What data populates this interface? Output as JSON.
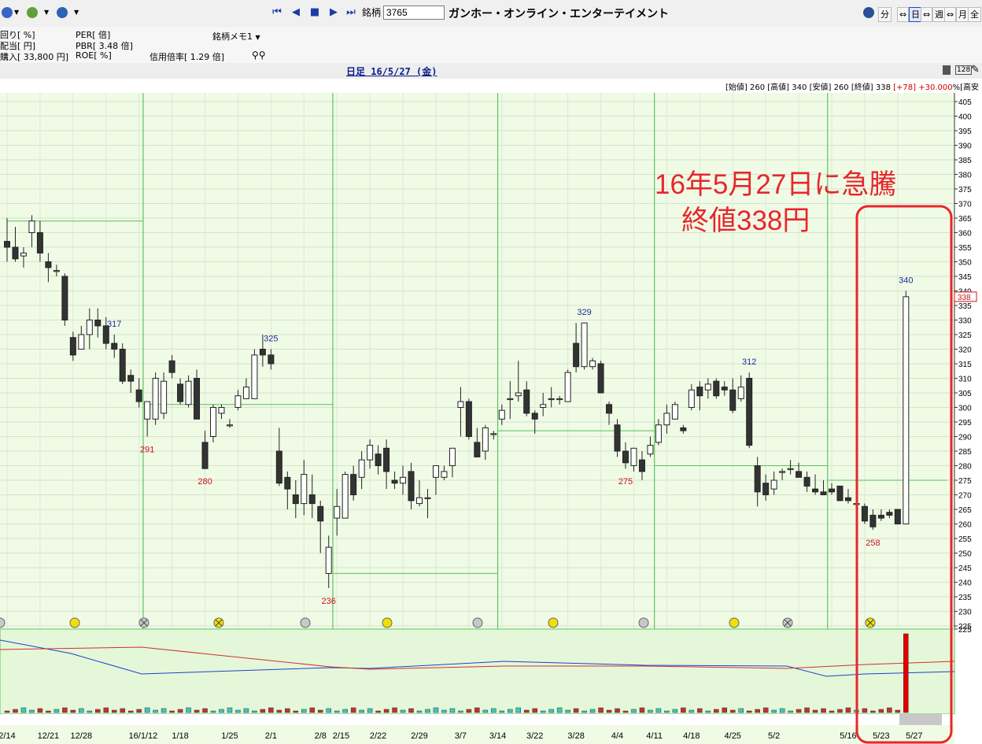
{
  "toolbar": {
    "code_label": "銘柄",
    "code_value": "3765",
    "company_name": "ガンホー・オンライン・エンターテイメント",
    "timeframes": [
      "分",
      "日",
      "週",
      "月",
      "全"
    ],
    "active_timeframe": "日"
  },
  "info": {
    "yield": "回り[ %]",
    "dividend": "配当[ 円]",
    "purchase": "購入[ 33,800 円]",
    "per": "PER[ 倍]",
    "pbr": "PBR[ 3.48 倍]",
    "roe": "ROE[ %]",
    "memo": "銘柄メモ1",
    "margin_ratio": "信用倍率[ 1.29 倍]"
  },
  "chart_title": "日足 16/5/27 (金)",
  "ohlc": {
    "open_label": "[始値]",
    "open": "260",
    "high_label": "[高値]",
    "high": "340",
    "low_label": "[安値]",
    "low": "260",
    "close_label": "[終値]",
    "close": "338",
    "change": "[+78]",
    "change_pct": "+30.000",
    "trail": "%[高安"
  },
  "annotation": {
    "line1": "16年5月27日に急騰",
    "line2": "終値338円"
  },
  "chart_data": {
    "type": "candlestick",
    "title": "日足 16/5/27 (金)",
    "colors": {
      "up": "#ffffff",
      "down": "#333333",
      "annotation": "#e8262b",
      "marker_hi": "#1c2ca0",
      "marker_lo": "#c8141e",
      "price_tag": "#c8141e"
    },
    "ylim": [
      225,
      407
    ],
    "y_ticks": [
      225,
      230,
      235,
      240,
      245,
      250,
      255,
      260,
      265,
      270,
      275,
      280,
      285,
      290,
      295,
      300,
      305,
      310,
      315,
      320,
      325,
      330,
      335,
      340,
      345,
      350,
      355,
      360,
      365,
      370,
      375,
      380,
      385,
      390,
      395,
      400,
      405
    ],
    "x_tick_labels": [
      "2/14",
      "12/21",
      "12/28",
      "16/1/12",
      "1/18",
      "1/25",
      "2/1",
      "2/8",
      "2/15",
      "2/22",
      "2/29",
      "3/7",
      "3/14",
      "3/22",
      "3/28",
      "4/4",
      "4/11",
      "4/18",
      "4/25",
      "5/2",
      "5/16",
      "5/23",
      "5/27"
    ],
    "candles": [
      {
        "o": 357,
        "h": 365,
        "l": 350,
        "c": 355
      },
      {
        "o": 355,
        "h": 362,
        "l": 350,
        "c": 351
      },
      {
        "o": 352,
        "h": 355,
        "l": 348,
        "c": 353
      },
      {
        "o": 360,
        "h": 366,
        "l": 355,
        "c": 364
      },
      {
        "o": 360,
        "h": 364,
        "l": 350,
        "c": 353
      },
      {
        "o": 350,
        "h": 353,
        "l": 343,
        "c": 348
      },
      {
        "o": 347,
        "h": 349,
        "l": 345,
        "c": 347
      },
      {
        "o": 345,
        "h": 346,
        "l": 328,
        "c": 330
      },
      {
        "o": 324,
        "h": 326,
        "l": 316,
        "c": 318
      },
      {
        "o": 320,
        "h": 328,
        "l": 320,
        "c": 325
      },
      {
        "o": 325,
        "h": 334,
        "l": 320,
        "c": 330
      },
      {
        "o": 330,
        "h": 334,
        "l": 324,
        "c": 328
      },
      {
        "o": 328,
        "h": 331,
        "l": 320,
        "c": 322
      },
      {
        "o": 322,
        "h": 325,
        "l": 317,
        "c": 320
      },
      {
        "o": 320,
        "h": 322,
        "l": 308,
        "c": 309
      },
      {
        "o": 311,
        "h": 313,
        "l": 305,
        "c": 309
      },
      {
        "o": 306,
        "h": 310,
        "l": 300,
        "c": 302
      },
      {
        "o": 296,
        "h": 300,
        "l": 290,
        "c": 302
      },
      {
        "o": 296,
        "h": 312,
        "l": 294,
        "c": 310
      },
      {
        "o": 298,
        "h": 312,
        "l": 296,
        "c": 309
      },
      {
        "o": 316,
        "h": 318,
        "l": 310,
        "c": 312
      },
      {
        "o": 308,
        "h": 310,
        "l": 301,
        "c": 302
      },
      {
        "o": 301,
        "h": 311,
        "l": 300,
        "c": 309
      },
      {
        "o": 310,
        "h": 313,
        "l": 296,
        "c": 296
      },
      {
        "o": 288,
        "h": 292,
        "l": 279,
        "c": 279
      },
      {
        "o": 290,
        "h": 301,
        "l": 288,
        "c": 300
      },
      {
        "o": 298,
        "h": 301,
        "l": 296,
        "c": 300
      },
      {
        "o": 294,
        "h": 296,
        "l": 293,
        "c": 294
      },
      {
        "o": 300,
        "h": 306,
        "l": 299,
        "c": 304
      },
      {
        "o": 303,
        "h": 310,
        "l": 303,
        "c": 307
      },
      {
        "o": 303,
        "h": 320,
        "l": 303,
        "c": 318
      },
      {
        "o": 320,
        "h": 325,
        "l": 314,
        "c": 318
      },
      {
        "o": 318,
        "h": 320,
        "l": 313,
        "c": 315
      },
      {
        "o": 285,
        "h": 293,
        "l": 273,
        "c": 274
      },
      {
        "o": 276,
        "h": 278,
        "l": 265,
        "c": 272
      },
      {
        "o": 270,
        "h": 275,
        "l": 262,
        "c": 267
      },
      {
        "o": 267,
        "h": 282,
        "l": 263,
        "c": 277
      },
      {
        "o": 270,
        "h": 277,
        "l": 262,
        "c": 267
      },
      {
        "o": 266,
        "h": 268,
        "l": 250,
        "c": 261
      },
      {
        "o": 243,
        "h": 256,
        "l": 238,
        "c": 252
      },
      {
        "o": 262,
        "h": 272,
        "l": 256,
        "c": 266
      },
      {
        "o": 262,
        "h": 278,
        "l": 262,
        "c": 277
      },
      {
        "o": 277,
        "h": 280,
        "l": 268,
        "c": 270
      },
      {
        "o": 276,
        "h": 285,
        "l": 272,
        "c": 282
      },
      {
        "o": 282,
        "h": 289,
        "l": 279,
        "c": 287
      },
      {
        "o": 284,
        "h": 287,
        "l": 277,
        "c": 280
      },
      {
        "o": 286,
        "h": 289,
        "l": 272,
        "c": 278
      },
      {
        "o": 275,
        "h": 278,
        "l": 272,
        "c": 274
      },
      {
        "o": 274,
        "h": 280,
        "l": 270,
        "c": 276
      },
      {
        "o": 278,
        "h": 281,
        "l": 265,
        "c": 268
      },
      {
        "o": 267,
        "h": 275,
        "l": 266,
        "c": 269
      },
      {
        "o": 269,
        "h": 272,
        "l": 262,
        "c": 269
      },
      {
        "o": 276,
        "h": 279,
        "l": 270,
        "c": 280
      },
      {
        "o": 276,
        "h": 280,
        "l": 275,
        "c": 278
      },
      {
        "o": 280,
        "h": 284,
        "l": 276,
        "c": 286
      },
      {
        "o": 300,
        "h": 307,
        "l": 290,
        "c": 302
      },
      {
        "o": 302,
        "h": 303,
        "l": 289,
        "c": 290
      },
      {
        "o": 288,
        "h": 293,
        "l": 284,
        "c": 283
      },
      {
        "o": 285,
        "h": 294,
        "l": 282,
        "c": 293
      },
      {
        "o": 291,
        "h": 292,
        "l": 289,
        "c": 291
      },
      {
        "o": 296,
        "h": 301,
        "l": 294,
        "c": 299
      },
      {
        "o": 303,
        "h": 309,
        "l": 296,
        "c": 303
      },
      {
        "o": 304,
        "h": 316,
        "l": 302,
        "c": 305
      },
      {
        "o": 306,
        "h": 309,
        "l": 297,
        "c": 298
      },
      {
        "o": 298,
        "h": 299,
        "l": 291,
        "c": 296
      },
      {
        "o": 300,
        "h": 305,
        "l": 297,
        "c": 301
      },
      {
        "o": 303,
        "h": 307,
        "l": 300,
        "c": 303
      },
      {
        "o": 303,
        "h": 304,
        "l": 301,
        "c": 303
      },
      {
        "o": 302,
        "h": 313,
        "l": 302,
        "c": 312
      },
      {
        "o": 322,
        "h": 329,
        "l": 312,
        "c": 314
      },
      {
        "o": 314,
        "h": 329,
        "l": 313,
        "c": 329
      },
      {
        "o": 314,
        "h": 317,
        "l": 313,
        "c": 316
      },
      {
        "o": 315,
        "h": 316,
        "l": 305,
        "c": 305
      },
      {
        "o": 301,
        "h": 302,
        "l": 294,
        "c": 298
      },
      {
        "o": 294,
        "h": 296,
        "l": 283,
        "c": 285
      },
      {
        "o": 285,
        "h": 288,
        "l": 279,
        "c": 281
      },
      {
        "o": 280,
        "h": 285,
        "l": 278,
        "c": 286
      },
      {
        "o": 282,
        "h": 285,
        "l": 275,
        "c": 278
      },
      {
        "o": 284,
        "h": 290,
        "l": 283,
        "c": 287
      },
      {
        "o": 288,
        "h": 296,
        "l": 287,
        "c": 294
      },
      {
        "o": 294,
        "h": 301,
        "l": 291,
        "c": 298
      },
      {
        "o": 296,
        "h": 302,
        "l": 297,
        "c": 301
      },
      {
        "o": 293,
        "h": 294,
        "l": 291,
        "c": 292
      },
      {
        "o": 300,
        "h": 308,
        "l": 299,
        "c": 306
      },
      {
        "o": 307,
        "h": 309,
        "l": 299,
        "c": 304
      },
      {
        "o": 306,
        "h": 310,
        "l": 303,
        "c": 308
      },
      {
        "o": 309,
        "h": 310,
        "l": 303,
        "c": 304
      },
      {
        "o": 307,
        "h": 309,
        "l": 304,
        "c": 306
      },
      {
        "o": 306,
        "h": 310,
        "l": 298,
        "c": 299
      },
      {
        "o": 303,
        "h": 311,
        "l": 302,
        "c": 307
      },
      {
        "o": 310,
        "h": 312,
        "l": 286,
        "c": 287
      },
      {
        "o": 280,
        "h": 283,
        "l": 266,
        "c": 271
      },
      {
        "o": 274,
        "h": 277,
        "l": 268,
        "c": 270
      },
      {
        "o": 272,
        "h": 278,
        "l": 270,
        "c": 275
      },
      {
        "o": 278,
        "h": 279,
        "l": 275,
        "c": 278
      },
      {
        "o": 279,
        "h": 282,
        "l": 277,
        "c": 279
      },
      {
        "o": 278,
        "h": 281,
        "l": 276,
        "c": 276
      },
      {
        "o": 276,
        "h": 278,
        "l": 271,
        "c": 273
      },
      {
        "o": 272,
        "h": 277,
        "l": 270,
        "c": 271
      },
      {
        "o": 271,
        "h": 275,
        "l": 270,
        "c": 270
      },
      {
        "o": 272,
        "h": 274,
        "l": 270,
        "c": 271
      },
      {
        "o": 273,
        "h": 273,
        "l": 268,
        "c": 268
      },
      {
        "o": 269,
        "h": 272,
        "l": 267,
        "c": 268
      },
      {
        "o": 267,
        "h": 269,
        "l": 266,
        "c": 267
      },
      {
        "o": 266,
        "h": 267,
        "l": 260,
        "c": 261
      },
      {
        "o": 263,
        "h": 265,
        "l": 258,
        "c": 259
      },
      {
        "o": 263,
        "h": 265,
        "l": 261,
        "c": 262
      },
      {
        "o": 264,
        "h": 265,
        "l": 262,
        "c": 263
      },
      {
        "o": 265,
        "h": 265,
        "l": 260,
        "c": 260
      },
      {
        "o": 260,
        "h": 340,
        "l": 260,
        "c": 338
      }
    ],
    "price_labels": {
      "high": [
        {
          "i": 13,
          "text": "317"
        },
        {
          "i": 32,
          "text": "325"
        },
        {
          "i": 70,
          "text": "329"
        },
        {
          "i": 90,
          "text": "312"
        },
        {
          "i": 109,
          "text": "340"
        }
      ],
      "low": [
        {
          "i": 17,
          "text": "291"
        },
        {
          "i": 24,
          "text": "280"
        },
        {
          "i": 39,
          "text": "236"
        },
        {
          "i": 75,
          "text": "275"
        },
        {
          "i": 105,
          "text": "258"
        }
      ]
    },
    "current_price_tag": "338"
  }
}
